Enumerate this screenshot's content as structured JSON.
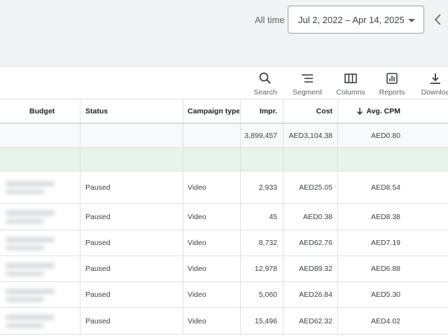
{
  "header": {
    "range_label": "All time",
    "date_range": "Jul 2, 2022 – Apr 14, 2025"
  },
  "toolbar": {
    "items": [
      {
        "label": "Search",
        "icon": "search-icon"
      },
      {
        "label": "Segment",
        "icon": "segment-icon"
      },
      {
        "label": "Columns",
        "icon": "columns-icon"
      },
      {
        "label": "Reports",
        "icon": "reports-icon"
      },
      {
        "label": "Downloa",
        "icon": "download-icon"
      }
    ]
  },
  "table": {
    "columns": [
      "Budget",
      "Status",
      "Campaign type",
      "Impr.",
      "Cost",
      "Avg. CPM"
    ],
    "sort_column": "Avg. CPM",
    "total": {
      "impr": "3,899,457",
      "cost": "AED3,104.38",
      "cpm": "AED0.80"
    },
    "rows": [
      {
        "status": "Paused",
        "type": "Video",
        "impr": "2,933",
        "cost": "AED25.05",
        "cpm": "AED8.54"
      },
      {
        "status": "Paused",
        "type": "Video",
        "impr": "45",
        "cost": "AED0.38",
        "cpm": "AED8.38"
      },
      {
        "status": "Paused",
        "type": "Video",
        "impr": "8,732",
        "cost": "AED62.76",
        "cpm": "AED7.19"
      },
      {
        "status": "Paused",
        "type": "Video",
        "impr": "12,978",
        "cost": "AED89.32",
        "cpm": "AED6.88"
      },
      {
        "status": "Paused",
        "type": "Video",
        "impr": "5,060",
        "cost": "AED26.84",
        "cpm": "AED5.30"
      },
      {
        "status": "Paused",
        "type": "Video",
        "impr": "15,496",
        "cost": "AED62.32",
        "cpm": "AED4.02"
      }
    ]
  }
}
